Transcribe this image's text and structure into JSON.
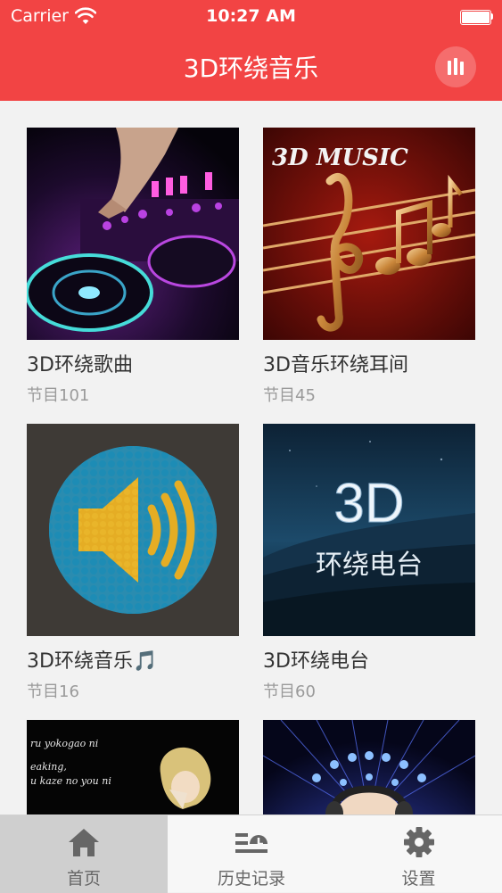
{
  "status_bar": {
    "carrier": "Carrier",
    "time": "10:27 AM"
  },
  "nav": {
    "title": "3D环绕音乐",
    "icon": "equalizer-icon"
  },
  "cards": [
    {
      "title": "3D环绕歌曲",
      "subtitle": "节目101"
    },
    {
      "title": "3D音乐环绕耳间",
      "subtitle": "节目45",
      "art_text": "3D MUSIC"
    },
    {
      "title": "3D环绕音乐🎵",
      "subtitle": "节目16"
    },
    {
      "title": "3D环绕电台",
      "subtitle": "节目60",
      "art_text_1": "3D",
      "art_text_2": "环绕电台"
    },
    {
      "art_lines": [
        "ru yokogao ni",
        "eaking,",
        "u kaze no you ni"
      ]
    },
    {}
  ],
  "tabs": [
    {
      "label": "首页",
      "icon": "home-icon",
      "active": true
    },
    {
      "label": "历史记录",
      "icon": "history-icon",
      "active": false
    },
    {
      "label": "设置",
      "icon": "gear-icon",
      "active": false
    }
  ],
  "colors": {
    "accent": "#f24444",
    "tab_active_bg": "#cfcfcf",
    "subtitle": "#9a9a9a"
  }
}
